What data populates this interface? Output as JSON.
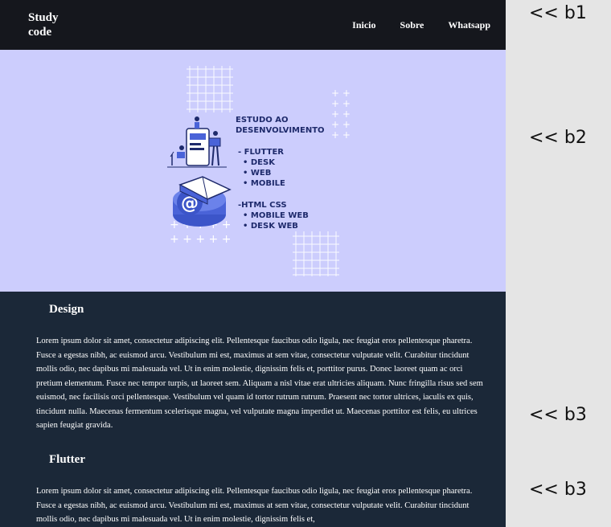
{
  "navbar": {
    "brand": "Study\ncode",
    "links": [
      "Inicio",
      "Sobre",
      "Whatsapp"
    ]
  },
  "hero": {
    "title_line1": "ESTUDO AO",
    "title_line2": "DESENVOLVIMENTO",
    "group1_heading": "- FLUTTER",
    "group1_items": [
      "• DESK",
      "• WEB",
      "• MOBILE"
    ],
    "group2_heading": "-HTML CSS",
    "group2_items": [
      "• MOBILE WEB",
      "• DESK WEB"
    ]
  },
  "sections": [
    {
      "title": "Design",
      "text": "Lorem ipsum dolor sit amet, consectetur adipiscing elit. Pellentesque faucibus odio ligula, nec feugiat eros pellentesque pharetra. Fusce a egestas nibh, ac euismod arcu. Vestibulum mi est, maximus at sem vitae, consectetur vulputate velit. Curabitur tincidunt mollis odio, nec dapibus mi malesuada vel. Ut in enim molestie, dignissim felis et, porttitor purus. Donec laoreet quam ac orci pretium elementum. Fusce nec tempor turpis, ut laoreet sem. Aliquam a nisl vitae erat ultricies aliquam. Nunc fringilla risus sed sem euismod, nec facilisis orci pellentesque. Vestibulum vel quam id tortor rutrum rutrum. Praesent nec tortor ultrices, iaculis ex quis, tincidunt nulla. Maecenas fermentum scelerisque magna, vel vulputate magna imperdiet ut. Maecenas porttitor est felis, eu ultrices sapien feugiat gravida."
    },
    {
      "title": "Flutter",
      "text": "Lorem ipsum dolor sit amet, consectetur adipiscing elit. Pellentesque faucibus odio ligula, nec feugiat eros pellentesque pharetra. Fusce a egestas nibh, ac euismod arcu. Vestibulum mi est, maximus at sem vitae, consectetur vulputate velit. Curabitur tincidunt mollis odio, nec dapibus mi malesuada vel. Ut in enim molestie, dignissim felis et,"
    }
  ],
  "annotations": [
    "<< b1",
    "<< b2",
    "<< b3",
    "<< b3"
  ],
  "colors": {
    "navbar_bg": "#15171d",
    "hero_bg": "#cccdfd",
    "content_bg": "#1b2838",
    "illustration_navy": "#1e2a6b",
    "illustration_blue": "#4a63d8"
  }
}
